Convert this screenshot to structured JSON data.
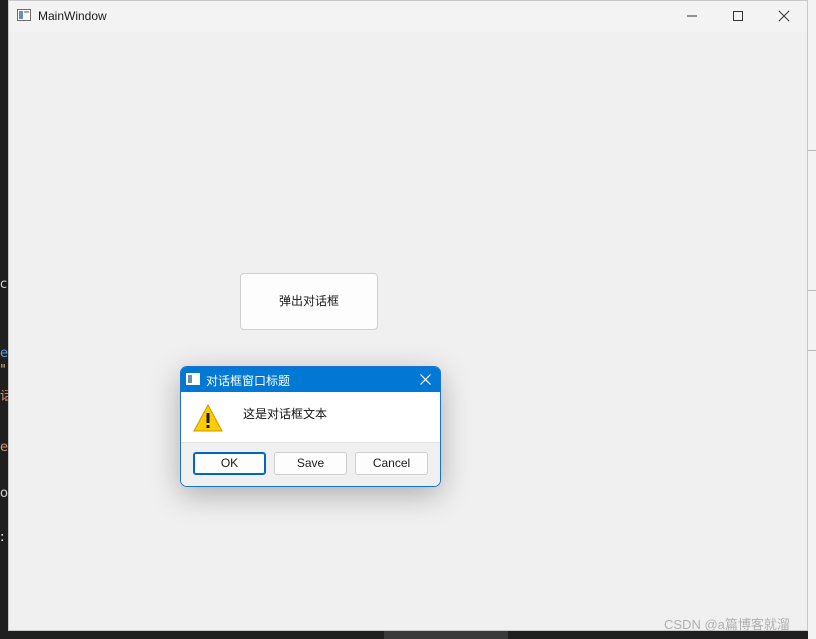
{
  "main_window": {
    "title": "MainWindow",
    "popup_button_label": "弹出对话框"
  },
  "dialog": {
    "title": "对话框窗口标题",
    "message": "这是对话框文本",
    "buttons": {
      "ok": "OK",
      "save": "Save",
      "cancel": "Cancel"
    },
    "icon": "warning-icon"
  },
  "background_editor": {
    "left_glyphs": [
      "c",
      "e",
      "\"",
      "话",
      "e",
      "o",
      ":"
    ]
  },
  "watermark": "CSDN @a篇博客就溜",
  "colors": {
    "dialog_accent": "#0078d4",
    "window_bg": "#f0f0f0",
    "warning": "#ffcc00"
  }
}
